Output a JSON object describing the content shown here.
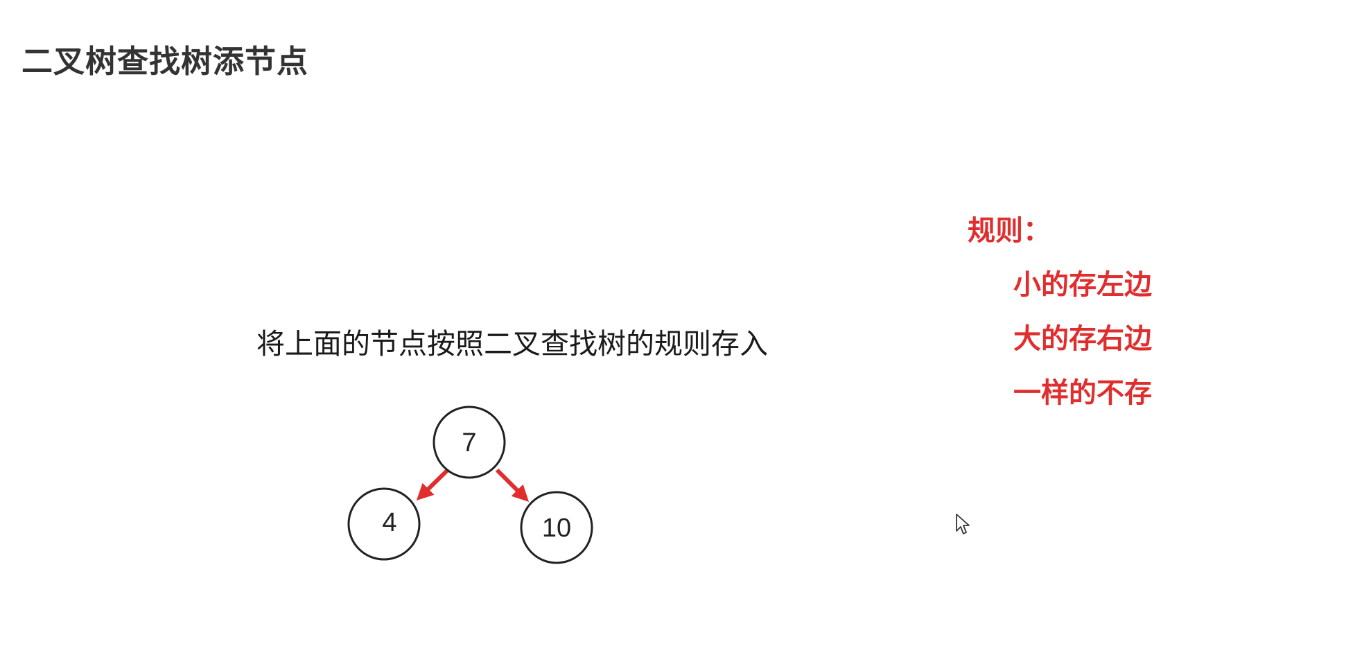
{
  "title": "二叉树查找树添节点",
  "instruction": "将上面的节点按照二叉查找树的规则存入",
  "rules": {
    "heading": "规则：",
    "items": [
      "小的存左边",
      "大的存右边",
      "一样的不存"
    ],
    "color": "#e02d2d"
  },
  "tree": {
    "root": "7",
    "left": "4",
    "right": "10",
    "arrow_color": "#e02d2d"
  }
}
